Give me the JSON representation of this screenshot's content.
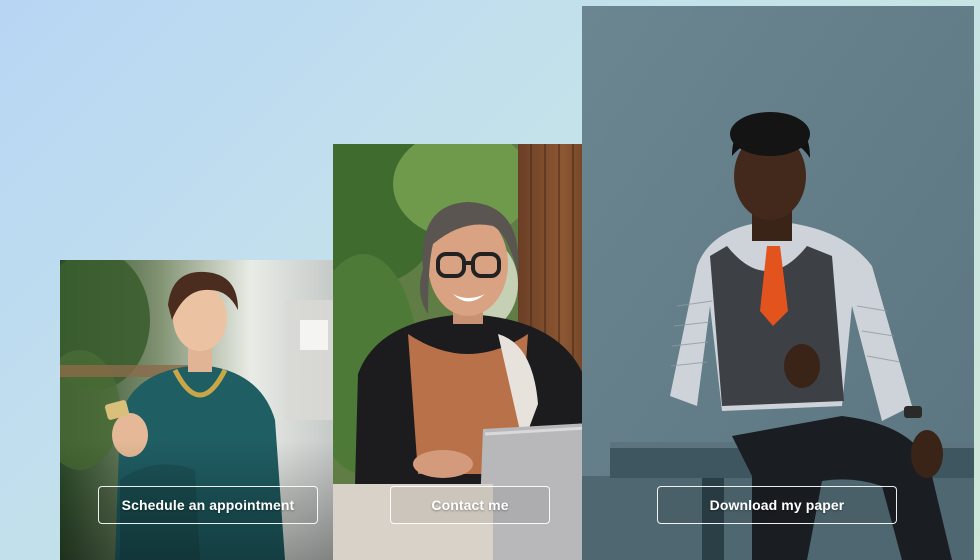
{
  "cards": [
    {
      "button_label": "Schedule an appointment",
      "photo_subject": "woman-holding-phone-photo"
    },
    {
      "button_label": "Contact me",
      "photo_subject": "woman-with-glasses-laptop-photo"
    },
    {
      "button_label": "Download my paper",
      "photo_subject": "man-in-vest-photo"
    }
  ],
  "colors": {
    "background_start": "#b8d6f4",
    "background_end": "#cfe8d8",
    "button_border": "#ffffff",
    "button_text": "#ffffff"
  }
}
